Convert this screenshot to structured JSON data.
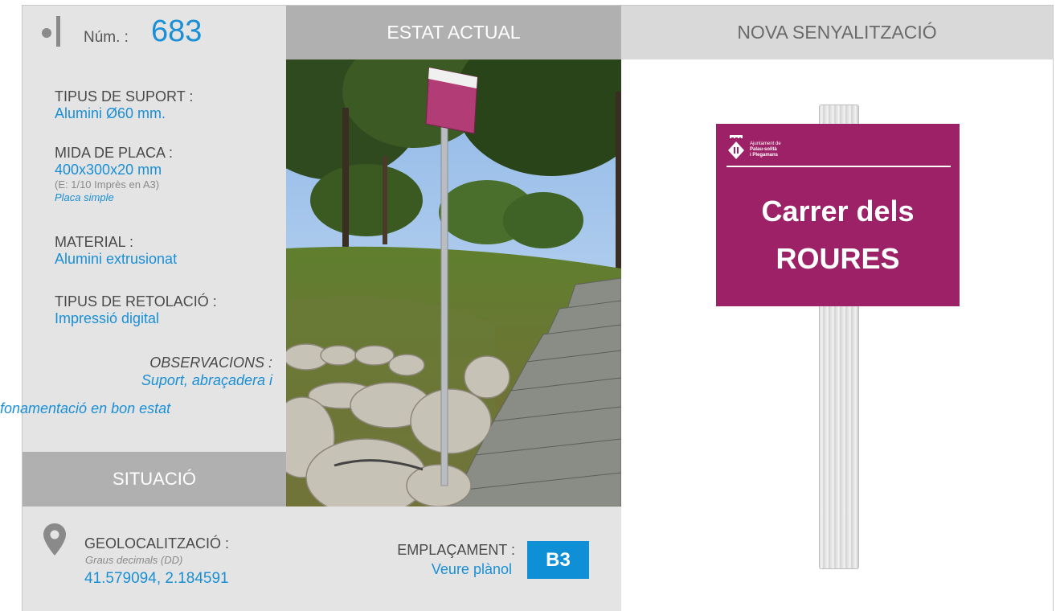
{
  "header": {
    "num_label": "Núm. :",
    "num_value": "683",
    "estat_actual": "ESTAT ACTUAL",
    "nova_senyalitzacio": "NOVA SENYALITZACIÓ"
  },
  "specs": {
    "tipus_suport_label": "TIPUS DE SUPORT :",
    "tipus_suport_value": "Alumini Ø60 mm.",
    "mida_placa_label": "MIDA DE PLACA :",
    "mida_placa_value": "400x300x20 mm",
    "mida_placa_scale": "(E: 1/10 Imprès en A3)",
    "mida_placa_type": "Placa simple",
    "material_label": "MATERIAL :",
    "material_value": "Alumini extrusionat",
    "retolacio_label": "TIPUS DE RETOLACIÓ :",
    "retolacio_value": "Impressió digital",
    "observacions_label": "OBSERVACIONS :",
    "observacions_line1": "Suport, abraçadera i",
    "observacions_line2": "fonamentació en bon estat"
  },
  "situacio": {
    "title": "SITUACIÓ",
    "geo_label": "GEOLOCALITZACIÓ :",
    "geo_sub": "Graus decimals (DD)",
    "geo_value": "41.579094, 2.184591",
    "emplacament_label": "EMPLAÇAMENT :",
    "emplacament_value": "Veure plànol",
    "emplacament_code": "B3"
  },
  "sign": {
    "org_line1": "Ajuntament de",
    "org_line2": "Palau-solità",
    "org_line3": "i Plegamans",
    "street_line1": "Carrer dels",
    "street_line2": "ROURES",
    "plate_color": "#9c2166"
  },
  "colors": {
    "accent": "#1a8fd5",
    "badge": "#0e8fd6",
    "header_dark": "#b0b0b0",
    "header_light": "#d9d9d9",
    "panel": "#e4e4e4"
  }
}
